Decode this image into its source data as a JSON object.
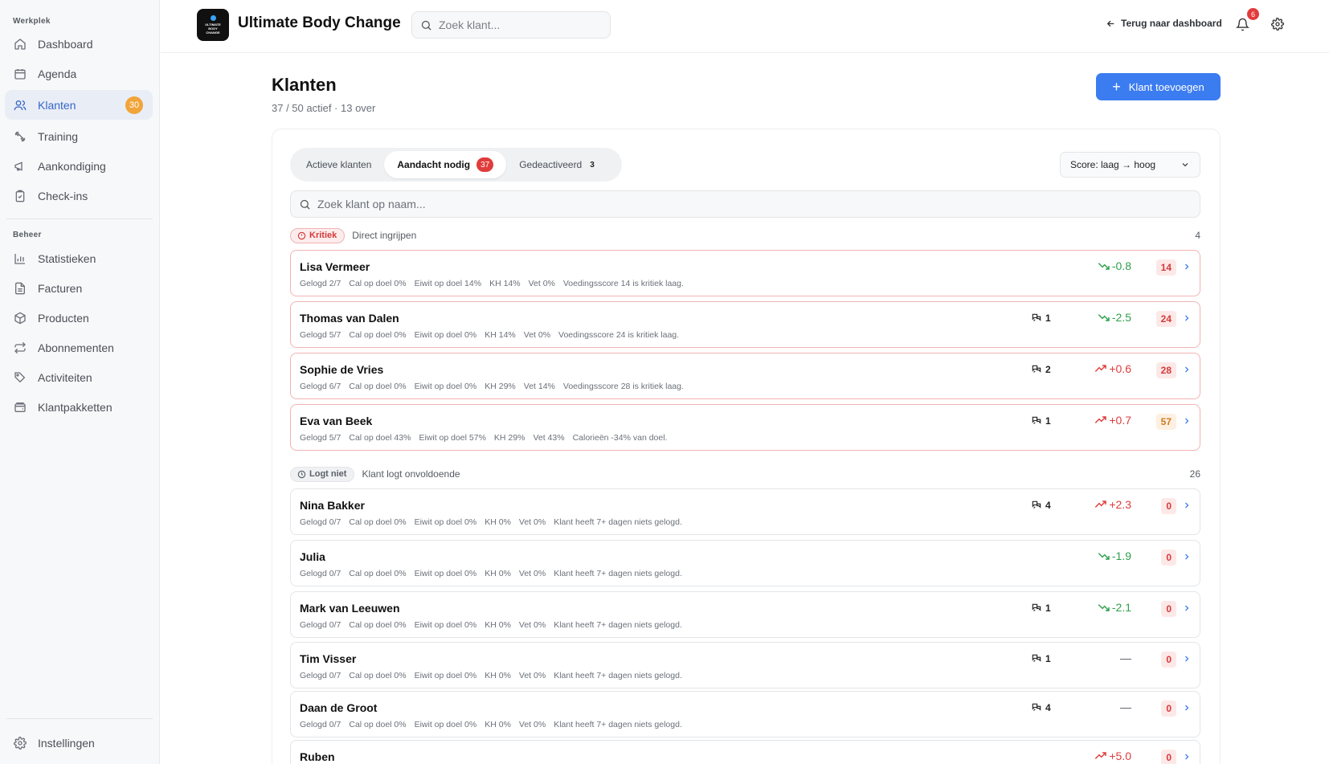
{
  "sidebar": {
    "section_werkplek": "Werkplek",
    "section_beheer": "Beheer",
    "items": [
      {
        "label": "Dashboard",
        "icon": "home-icon"
      },
      {
        "label": "Agenda",
        "icon": "calendar-icon"
      },
      {
        "label": "Klanten",
        "icon": "users-icon",
        "badge": "30",
        "active": true
      },
      {
        "label": "Training",
        "icon": "dumbbell-icon"
      },
      {
        "label": "Aankondiging",
        "icon": "megaphone-icon"
      },
      {
        "label": "Check-ins",
        "icon": "clipboard-check-icon"
      }
    ],
    "beheer_items": [
      {
        "label": "Statistieken",
        "icon": "bar-chart-icon"
      },
      {
        "label": "Facturen",
        "icon": "file-text-icon"
      },
      {
        "label": "Producten",
        "icon": "package-icon"
      },
      {
        "label": "Abonnementen",
        "icon": "repeat-icon"
      },
      {
        "label": "Activiteiten",
        "icon": "tag-icon"
      },
      {
        "label": "Klantpakketten",
        "icon": "wallet-icon"
      }
    ],
    "settings_label": "Instellingen"
  },
  "header": {
    "logo_lines": [
      "ULTIMATE",
      "BODY",
      "CHANGE"
    ],
    "app_title": "Ultimate Body Change",
    "search_placeholder": "Zoek klant...",
    "back_label": "Terug naar dashboard",
    "notification_count": "6"
  },
  "main": {
    "title": "Klanten",
    "subtitle": "37 / 50 actief · 13 over",
    "add_button": "Klant toevoegen",
    "tabs": [
      {
        "label": "Actieve klanten"
      },
      {
        "label": "Aandacht nodig",
        "count": "37",
        "active": true
      },
      {
        "label": "Gedeactiveerd",
        "count": "3"
      }
    ],
    "sort_label": "Score: laag → hoog",
    "list_search_placeholder": "Zoek klant op naam...",
    "groups": [
      {
        "badge": "Kritiek",
        "description": "Direct ingrijpen",
        "count": "4"
      },
      {
        "badge": "Logt niet",
        "description": "Klant logt onvoldoende",
        "count": "26"
      }
    ],
    "clients": [
      {
        "name": "Lisa Vermeer",
        "logged": "Gelogd 2/7",
        "cal": "Cal op doel 0%",
        "eiwit": "Eiwit op doel 14%",
        "kh": "KH 14%",
        "vet": "Vet 0%",
        "note": "Voedingsscore 14 is kritiek laag.",
        "messages": "",
        "trend": "-0.8",
        "score": "14"
      },
      {
        "name": "Thomas van Dalen",
        "logged": "Gelogd 5/7",
        "cal": "Cal op doel 0%",
        "eiwit": "Eiwit op doel 0%",
        "kh": "KH 14%",
        "vet": "Vet 0%",
        "note": "Voedingsscore 24 is kritiek laag.",
        "messages": "1",
        "trend": "-2.5",
        "score": "24"
      },
      {
        "name": "Sophie de Vries",
        "logged": "Gelogd 6/7",
        "cal": "Cal op doel 0%",
        "eiwit": "Eiwit op doel 0%",
        "kh": "KH 29%",
        "vet": "Vet 14%",
        "note": "Voedingsscore 28 is kritiek laag.",
        "messages": "2",
        "trend": "+0.6",
        "score": "28"
      },
      {
        "name": "Eva van Beek",
        "logged": "Gelogd 5/7",
        "cal": "Cal op doel 43%",
        "eiwit": "Eiwit op doel 57%",
        "kh": "KH 29%",
        "vet": "Vet 43%",
        "note": "Calorieën -34% van doel.",
        "messages": "1",
        "trend": "+0.7",
        "score": "57"
      },
      {
        "name": "Nina Bakker",
        "logged": "Gelogd 0/7",
        "cal": "Cal op doel 0%",
        "eiwit": "Eiwit op doel 0%",
        "kh": "KH 0%",
        "vet": "Vet 0%",
        "note": "Klant heeft 7+ dagen niets gelogd.",
        "messages": "4",
        "trend": "+2.3",
        "score": "0"
      },
      {
        "name": "Julia",
        "logged": "Gelogd 0/7",
        "cal": "Cal op doel 0%",
        "eiwit": "Eiwit op doel 0%",
        "kh": "KH 0%",
        "vet": "Vet 0%",
        "note": "Klant heeft 7+ dagen niets gelogd.",
        "messages": "",
        "trend": "-1.9",
        "score": "0"
      },
      {
        "name": "Mark van Leeuwen",
        "logged": "Gelogd 0/7",
        "cal": "Cal op doel 0%",
        "eiwit": "Eiwit op doel 0%",
        "kh": "KH 0%",
        "vet": "Vet 0%",
        "note": "Klant heeft 7+ dagen niets gelogd.",
        "messages": "1",
        "trend": "-2.1",
        "score": "0"
      },
      {
        "name": "Tim Visser",
        "logged": "Gelogd 0/7",
        "cal": "Cal op doel 0%",
        "eiwit": "Eiwit op doel 0%",
        "kh": "KH 0%",
        "vet": "Vet 0%",
        "note": "Klant heeft 7+ dagen niets gelogd.",
        "messages": "1",
        "trend": "—",
        "score": "0"
      },
      {
        "name": "Daan de Groot",
        "logged": "Gelogd 0/7",
        "cal": "Cal op doel 0%",
        "eiwit": "Eiwit op doel 0%",
        "kh": "KH 0%",
        "vet": "Vet 0%",
        "note": "Klant heeft 7+ dagen niets gelogd.",
        "messages": "4",
        "trend": "—",
        "score": "0"
      },
      {
        "name": "Ruben",
        "logged": "",
        "cal": "",
        "eiwit": "",
        "kh": "",
        "vet": "",
        "note": "",
        "messages": "",
        "trend": "+5.0",
        "score": "0"
      }
    ]
  },
  "colors": {
    "accent": "#3b7cf0",
    "active_nav": "#3566c9",
    "critical": "#e03c3c",
    "positive": "#2fa04c",
    "badge_orange": "#f1a43a"
  }
}
